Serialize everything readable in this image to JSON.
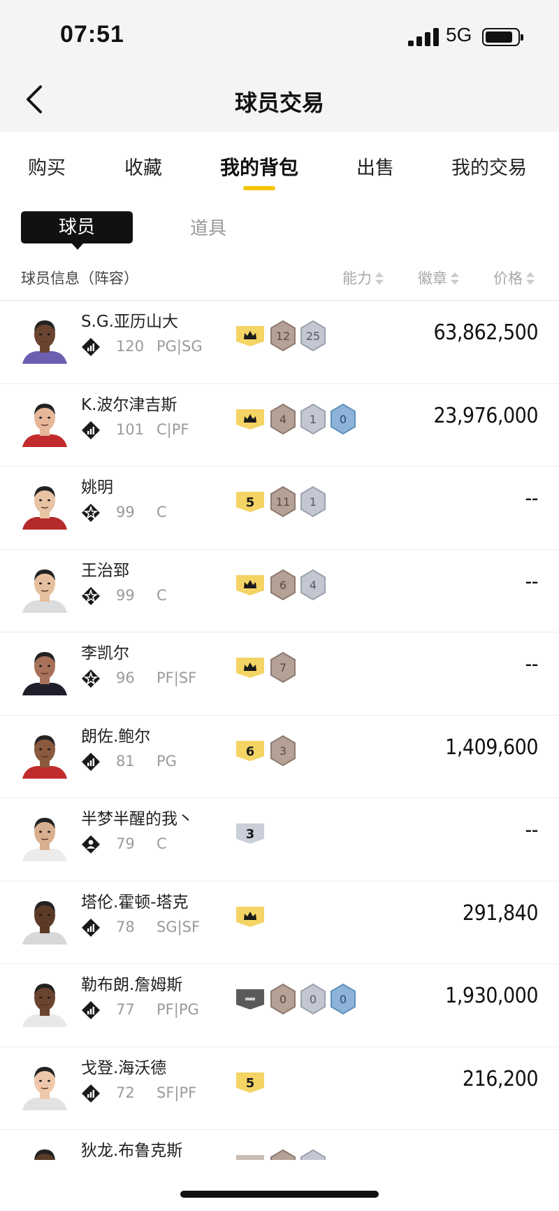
{
  "status": {
    "time": "07:51",
    "network": "5G"
  },
  "nav": {
    "title": "球员交易"
  },
  "tabs": [
    {
      "label": "购买",
      "active": false
    },
    {
      "label": "收藏",
      "active": false
    },
    {
      "label": "我的背包",
      "active": true
    },
    {
      "label": "出售",
      "active": false
    },
    {
      "label": "我的交易",
      "active": false
    }
  ],
  "segments": {
    "active": "球员",
    "inactive": "道具"
  },
  "columns": {
    "info": "球员信息（阵容）",
    "ability": "能力",
    "badge": "徽章",
    "price": "价格"
  },
  "colors": {
    "accent": "#f5c400",
    "gold_tier": "#f4d464",
    "bronze_badge": "#b5a196",
    "silver_badge": "#c3c7d2",
    "blue_badge": "#8db4d8"
  },
  "players": [
    {
      "name": "S.G.亚历山大",
      "rating": "120",
      "position": "PG|SG",
      "rank_icon": "bars-diamond-icon",
      "tier": "crown",
      "badges": [
        [
          "bronze",
          "12"
        ],
        [
          "silver",
          "25"
        ]
      ],
      "price": "63,862,500",
      "skin": "#6b4430",
      "jersey": "#6c5fb0"
    },
    {
      "name": "K.波尔津吉斯",
      "rating": "101",
      "position": "C|PF",
      "rank_icon": "bars-diamond-icon",
      "tier": "crown",
      "badges": [
        [
          "bronze",
          "4"
        ],
        [
          "silver",
          "1"
        ],
        [
          "blue",
          "0"
        ]
      ],
      "price": "23,976,000",
      "skin": "#e7b79a",
      "jersey": "#c22b2b"
    },
    {
      "name": "姚明",
      "rating": "99",
      "position": "C",
      "rank_icon": "star-diamond-icon",
      "tier": "5",
      "badges": [
        [
          "bronze",
          "11"
        ],
        [
          "silver",
          "1"
        ]
      ],
      "price": "--",
      "skin": "#e8c3a4",
      "jersey": "#b52a2a"
    },
    {
      "name": "王治郅",
      "rating": "99",
      "position": "C",
      "rank_icon": "star-diamond-icon",
      "tier": "crown",
      "badges": [
        [
          "bronze",
          "6"
        ],
        [
          "silver",
          "4"
        ]
      ],
      "price": "--",
      "skin": "#e6c09e",
      "jersey": "#dcdcdc"
    },
    {
      "name": "李凯尔",
      "rating": "96",
      "position": "PF|SF",
      "rank_icon": "star-diamond-icon",
      "tier": "crown",
      "badges": [
        [
          "bronze",
          "7"
        ]
      ],
      "price": "--",
      "skin": "#a8715a",
      "jersey": "#1f1f2b"
    },
    {
      "name": "朗佐.鲍尔",
      "rating": "81",
      "position": "PG",
      "rank_icon": "bars-diamond-icon",
      "tier": "6",
      "badges": [
        [
          "bronze",
          "3"
        ]
      ],
      "price": "1,409,600",
      "skin": "#8a5a3e",
      "jersey": "#c22b2b"
    },
    {
      "name": "半梦半醒的我丶",
      "rating": "79",
      "position": "C",
      "rank_icon": "person-diamond-icon",
      "tier": "3",
      "badges": [],
      "price": "--",
      "skin": "#d9b08f",
      "jersey": "#ececec"
    },
    {
      "name": "塔伦.霍顿-塔克",
      "rating": "78",
      "position": "SG|SF",
      "rank_icon": "bars-diamond-icon",
      "tier": "crown",
      "badges": [],
      "price": "291,840",
      "skin": "#5b3a28",
      "jersey": "#d8d8d8"
    },
    {
      "name": "勒布朗.詹姆斯",
      "rating": "77",
      "position": "PF|PG",
      "rank_icon": "bars-diamond-icon",
      "tier": "dash",
      "badges": [
        [
          "bronze",
          "0"
        ],
        [
          "silver",
          "0"
        ],
        [
          "blue",
          "0"
        ]
      ],
      "price": "1,930,000",
      "skin": "#6b4430",
      "jersey": "#e8e8e8"
    },
    {
      "name": "戈登.海沃德",
      "rating": "72",
      "position": "SF|PF",
      "rank_icon": "bars-diamond-icon",
      "tier": "5",
      "badges": [],
      "price": "216,200",
      "skin": "#efc8ac",
      "jersey": "#e2e2e2"
    },
    {
      "name": "狄龙.布鲁克斯",
      "rating": "",
      "position": "",
      "rank_icon": "bars-diamond-icon",
      "tier": "gray",
      "badges": [
        [
          "bronze",
          ""
        ],
        [
          "silver",
          ""
        ]
      ],
      "price": "",
      "skin": "#5b3a28",
      "jersey": "#e0e0e0"
    }
  ]
}
